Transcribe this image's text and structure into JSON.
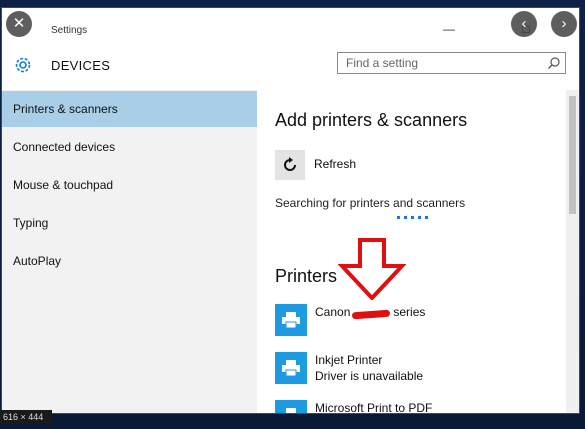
{
  "window": {
    "title": "Settings"
  },
  "header": {
    "section_title": "DEVICES",
    "search": {
      "placeholder": "Find a setting",
      "value": ""
    }
  },
  "sidebar": {
    "items": [
      {
        "label": "Printers & scanners",
        "selected": true
      },
      {
        "label": "Connected devices",
        "selected": false
      },
      {
        "label": "Mouse & touchpad",
        "selected": false
      },
      {
        "label": "Typing",
        "selected": false
      },
      {
        "label": "AutoPlay",
        "selected": false
      }
    ]
  },
  "content": {
    "add_heading": "Add printers & scanners",
    "refresh_label": "Refresh",
    "searching_text": "Searching for printers and scanners",
    "printers_heading": "Printers",
    "printers": [
      {
        "name_prefix": "Canon",
        "name_suffix": "series",
        "status": ""
      },
      {
        "name": "Inkjet Printer",
        "status": "Driver is unavailable"
      },
      {
        "name": "Microsoft Print to PDF",
        "status": ""
      }
    ]
  },
  "overlay": {
    "resolution_badge": "616 × 444"
  },
  "colors": {
    "accent": "#1e9ae0",
    "selected_bg": "#a9cfe8",
    "annotation": "#e01010"
  }
}
